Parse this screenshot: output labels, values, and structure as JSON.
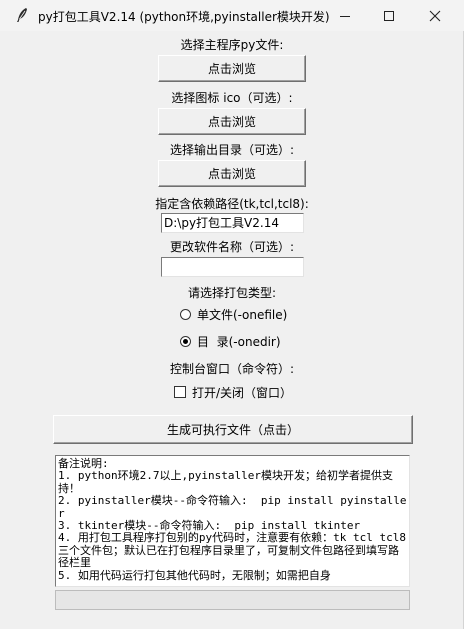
{
  "window": {
    "title": "py打包工具V2.14 (python环境,pyinstaller模块开发)",
    "icon": "feather-icon",
    "controls": [
      "minimize-icon",
      "maximize-icon",
      "close-icon"
    ]
  },
  "main_file": {
    "label": "选择主程序py文件:",
    "button": "点击浏览"
  },
  "icon_file": {
    "label": "选择图标 ico（可选）:",
    "button": "点击浏览"
  },
  "output_dir": {
    "label": "选择输出目录（可选）:",
    "button": "点击浏览"
  },
  "deps_path": {
    "label": "指定含依赖路径(tk,tcl,tcl8):",
    "value": "D:\\py打包工具V2.14"
  },
  "rename": {
    "label": "更改软件名称（可选）:",
    "value": ""
  },
  "pack_type": {
    "label": "请选择打包类型:",
    "options": [
      {
        "label": "单文件(-onefile)",
        "selected": false
      },
      {
        "label": "目  录(-onedir)",
        "selected": true
      }
    ]
  },
  "console": {
    "label": "控制台窗口（命令符）:",
    "checkbox_label": "打开/关闭（窗口）",
    "checked": false
  },
  "generate_button": "生成可执行文件（点击）",
  "notes": [
    "备注说明:",
    "1. python环境2.7以上,pyinstaller模块开发；给初学者提供支持！",
    "2. pyinstaller模块--命令符输入:  pip install pyinstaller",
    "3. tkinter模块--命令符输入:  pip install tkinter",
    "4. 用打包工具程序打包别的py代码时，注意要有依赖：tk tcl tcl8  三个文件包；默认已在打包程序目录里了，可复制文件包路径到填写路径栏里",
    "5. 如用代码运行打包其他代码时，无限制；如需把自身"
  ],
  "status_text": ""
}
